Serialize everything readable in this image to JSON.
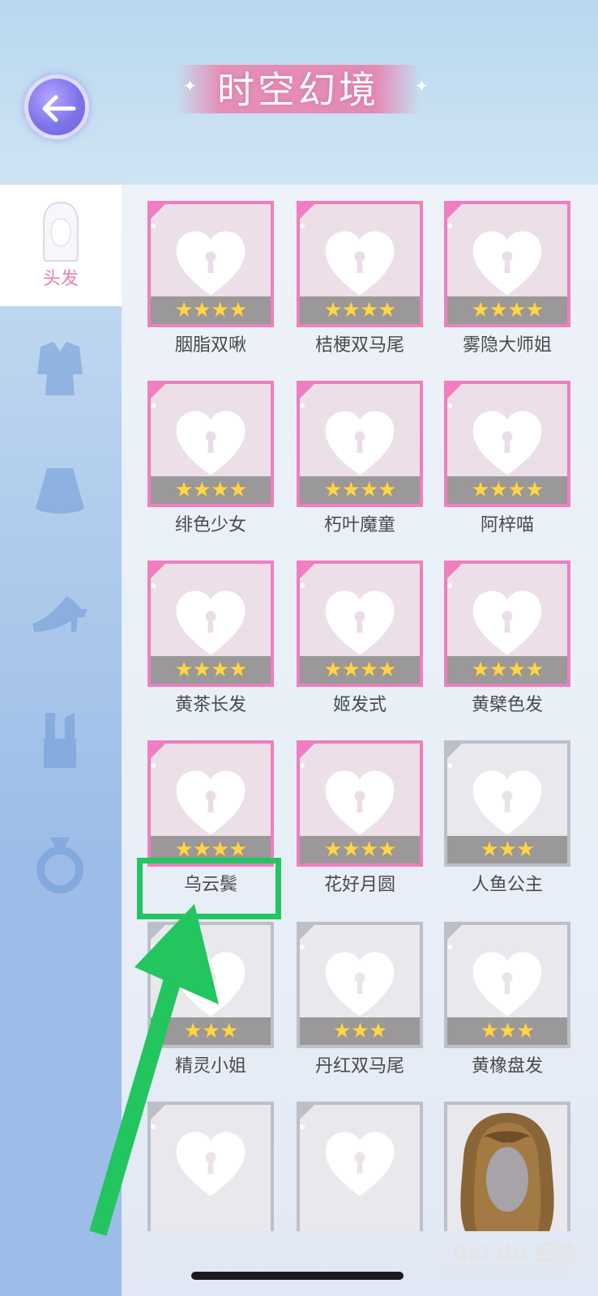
{
  "header": {
    "title": "时空幻境",
    "back_icon": "back-arrow-icon",
    "accent": "#e68fb8"
  },
  "sidebar": {
    "active_tab_label": "头发",
    "icons": [
      "hair-icon",
      "top-icon",
      "skirt-icon",
      "shoes-icon",
      "makeup-icon",
      "ring-icon"
    ]
  },
  "items": [
    {
      "name": "胭脂双啾",
      "stars": "★★★★"
    },
    {
      "name": "桔梗双马尾",
      "stars": "★★★★"
    },
    {
      "name": "雾隐大师姐",
      "stars": "★★★★"
    },
    {
      "name": "绯色少女",
      "stars": "★★★★"
    },
    {
      "name": "朽叶魔童",
      "stars": "★★★★"
    },
    {
      "name": "阿梓喵",
      "stars": "★★★★"
    },
    {
      "name": "黄茶长发",
      "stars": "★★★★"
    },
    {
      "name": "姬发式",
      "stars": "★★★★"
    },
    {
      "name": "黄檗色发",
      "stars": "★★★★"
    },
    {
      "name": "乌云鬓",
      "stars": "★★★★"
    },
    {
      "name": "花好月圆",
      "stars": "★★★★"
    },
    {
      "name": "人鱼公主",
      "stars": "★★★"
    },
    {
      "name": "精灵小姐",
      "stars": "★★★"
    },
    {
      "name": "丹红双马尾",
      "stars": "★★★"
    },
    {
      "name": "黄橡盘发",
      "stars": "★★★"
    }
  ],
  "watermark": {
    "brand": "Bai du 经验",
    "url": "jingyan.baidu.com"
  },
  "colors": {
    "highlight": "#22c55e",
    "pink_border": "#f07ec0",
    "gray_border": "#bdbfc7"
  }
}
